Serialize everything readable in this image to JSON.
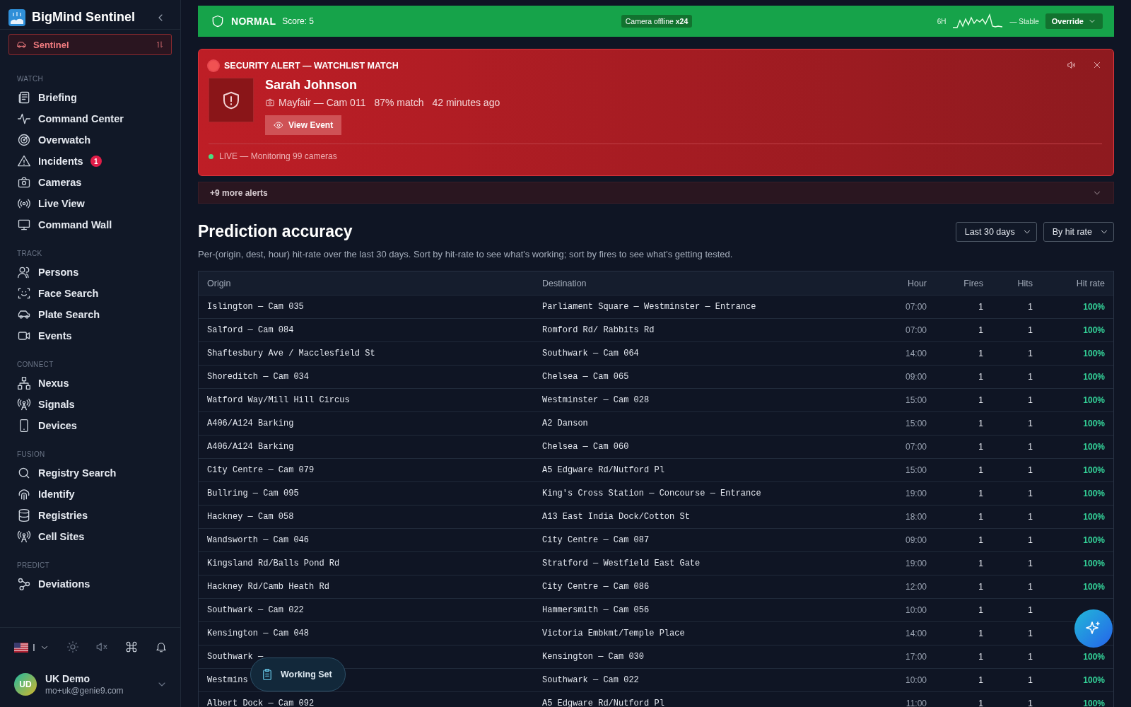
{
  "sidebar": {
    "brand": "BigMind Sentinel",
    "mode": "Sentinel",
    "sections": [
      {
        "title": "WATCH",
        "items": [
          {
            "label": "Briefing"
          },
          {
            "label": "Command Center"
          },
          {
            "label": "Overwatch"
          },
          {
            "label": "Incidents",
            "badge": "1"
          },
          {
            "label": "Cameras"
          },
          {
            "label": "Live View"
          },
          {
            "label": "Command Wall"
          }
        ]
      },
      {
        "title": "TRACK",
        "items": [
          {
            "label": "Persons"
          },
          {
            "label": "Face Search"
          },
          {
            "label": "Plate Search"
          },
          {
            "label": "Events"
          }
        ]
      },
      {
        "title": "CONNECT",
        "items": [
          {
            "label": "Nexus"
          },
          {
            "label": "Signals"
          },
          {
            "label": "Devices"
          }
        ]
      },
      {
        "title": "FUSION",
        "items": [
          {
            "label": "Registry Search"
          },
          {
            "label": "Identify"
          },
          {
            "label": "Registries"
          },
          {
            "label": "Cell Sites"
          }
        ]
      },
      {
        "title": "PREDICT",
        "items": [
          {
            "label": "Deviations"
          }
        ]
      }
    ],
    "language": "I",
    "user": {
      "initials": "UD",
      "name": "UK Demo",
      "email": "mo+uk@genie9.com"
    }
  },
  "status_bar": {
    "level": "NORMAL",
    "score": "Score: 5",
    "badge": "Camera offline",
    "badge_count": "x24",
    "range": "6H",
    "trend": "— Stable",
    "override": "Override"
  },
  "alert": {
    "title": "SECURITY ALERT — WATCHLIST MATCH",
    "name": "Sarah Johnson",
    "camera": "Mayfair — Cam 011",
    "match": "87% match",
    "time": "42 minutes ago",
    "action": "View Event",
    "live": "LIVE — Monitoring 99 cameras"
  },
  "more_alerts": "+9 more alerts",
  "section": {
    "title": "Prediction accuracy",
    "description": "Per-(origin, dest, hour) hit-rate over the last 30 days. Sort by hit-rate to see what's working; sort by fires to see what's getting tested.",
    "period": "Last 30 days",
    "sort": "By hit rate"
  },
  "table": {
    "columns": [
      "Origin",
      "Destination",
      "Hour",
      "Fires",
      "Hits",
      "Hit rate"
    ],
    "rows": [
      [
        "Islington — Cam 035",
        "Parliament Square — Westminster — Entrance",
        "07:00",
        "1",
        "1",
        "100%"
      ],
      [
        "Salford — Cam 084",
        "Romford Rd/ Rabbits Rd",
        "07:00",
        "1",
        "1",
        "100%"
      ],
      [
        "Shaftesbury Ave / Macclesfield St",
        "Southwark — Cam 064",
        "14:00",
        "1",
        "1",
        "100%"
      ],
      [
        "Shoreditch — Cam 034",
        "Chelsea — Cam 065",
        "09:00",
        "1",
        "1",
        "100%"
      ],
      [
        "Watford Way/Mill Hill Circus",
        "Westminster — Cam 028",
        "15:00",
        "1",
        "1",
        "100%"
      ],
      [
        "A406/A124 Barking",
        "A2 Danson",
        "15:00",
        "1",
        "1",
        "100%"
      ],
      [
        "A406/A124 Barking",
        "Chelsea — Cam 060",
        "07:00",
        "1",
        "1",
        "100%"
      ],
      [
        "City Centre — Cam 079",
        "A5 Edgware Rd/Nutford Pl",
        "15:00",
        "1",
        "1",
        "100%"
      ],
      [
        "Bullring — Cam 095",
        "King's Cross Station — Concourse — Entrance",
        "19:00",
        "1",
        "1",
        "100%"
      ],
      [
        "Hackney — Cam 058",
        "A13 East India Dock/Cotton St",
        "18:00",
        "1",
        "1",
        "100%"
      ],
      [
        "Wandsworth — Cam 046",
        "City Centre — Cam 087",
        "09:00",
        "1",
        "1",
        "100%"
      ],
      [
        "Kingsland Rd/Balls Pond Rd",
        "Stratford — Westfield East Gate",
        "19:00",
        "1",
        "1",
        "100%"
      ],
      [
        "Hackney Rd/Camb Heath Rd",
        "City Centre — Cam 086",
        "12:00",
        "1",
        "1",
        "100%"
      ],
      [
        "Southwark — Cam 022",
        "Hammersmith — Cam 056",
        "10:00",
        "1",
        "1",
        ""
      ],
      [
        "Kensington — Cam 048",
        "Victoria Embkmt/Temple Place",
        "14:00",
        "1",
        "1",
        ""
      ],
      [
        "Southwark —",
        "Kensington — Cam 030",
        "17:00",
        "1",
        "1",
        "100%"
      ],
      [
        "Westmins",
        "Southwark — Cam 022",
        "10:00",
        "1",
        "1",
        "100%"
      ],
      [
        "Albert Dock — Cam 092",
        "A5 Edgware Rd/Nutford Pl",
        "11:00",
        "1",
        "1",
        "100%"
      ]
    ]
  },
  "working_set": "Working Set"
}
